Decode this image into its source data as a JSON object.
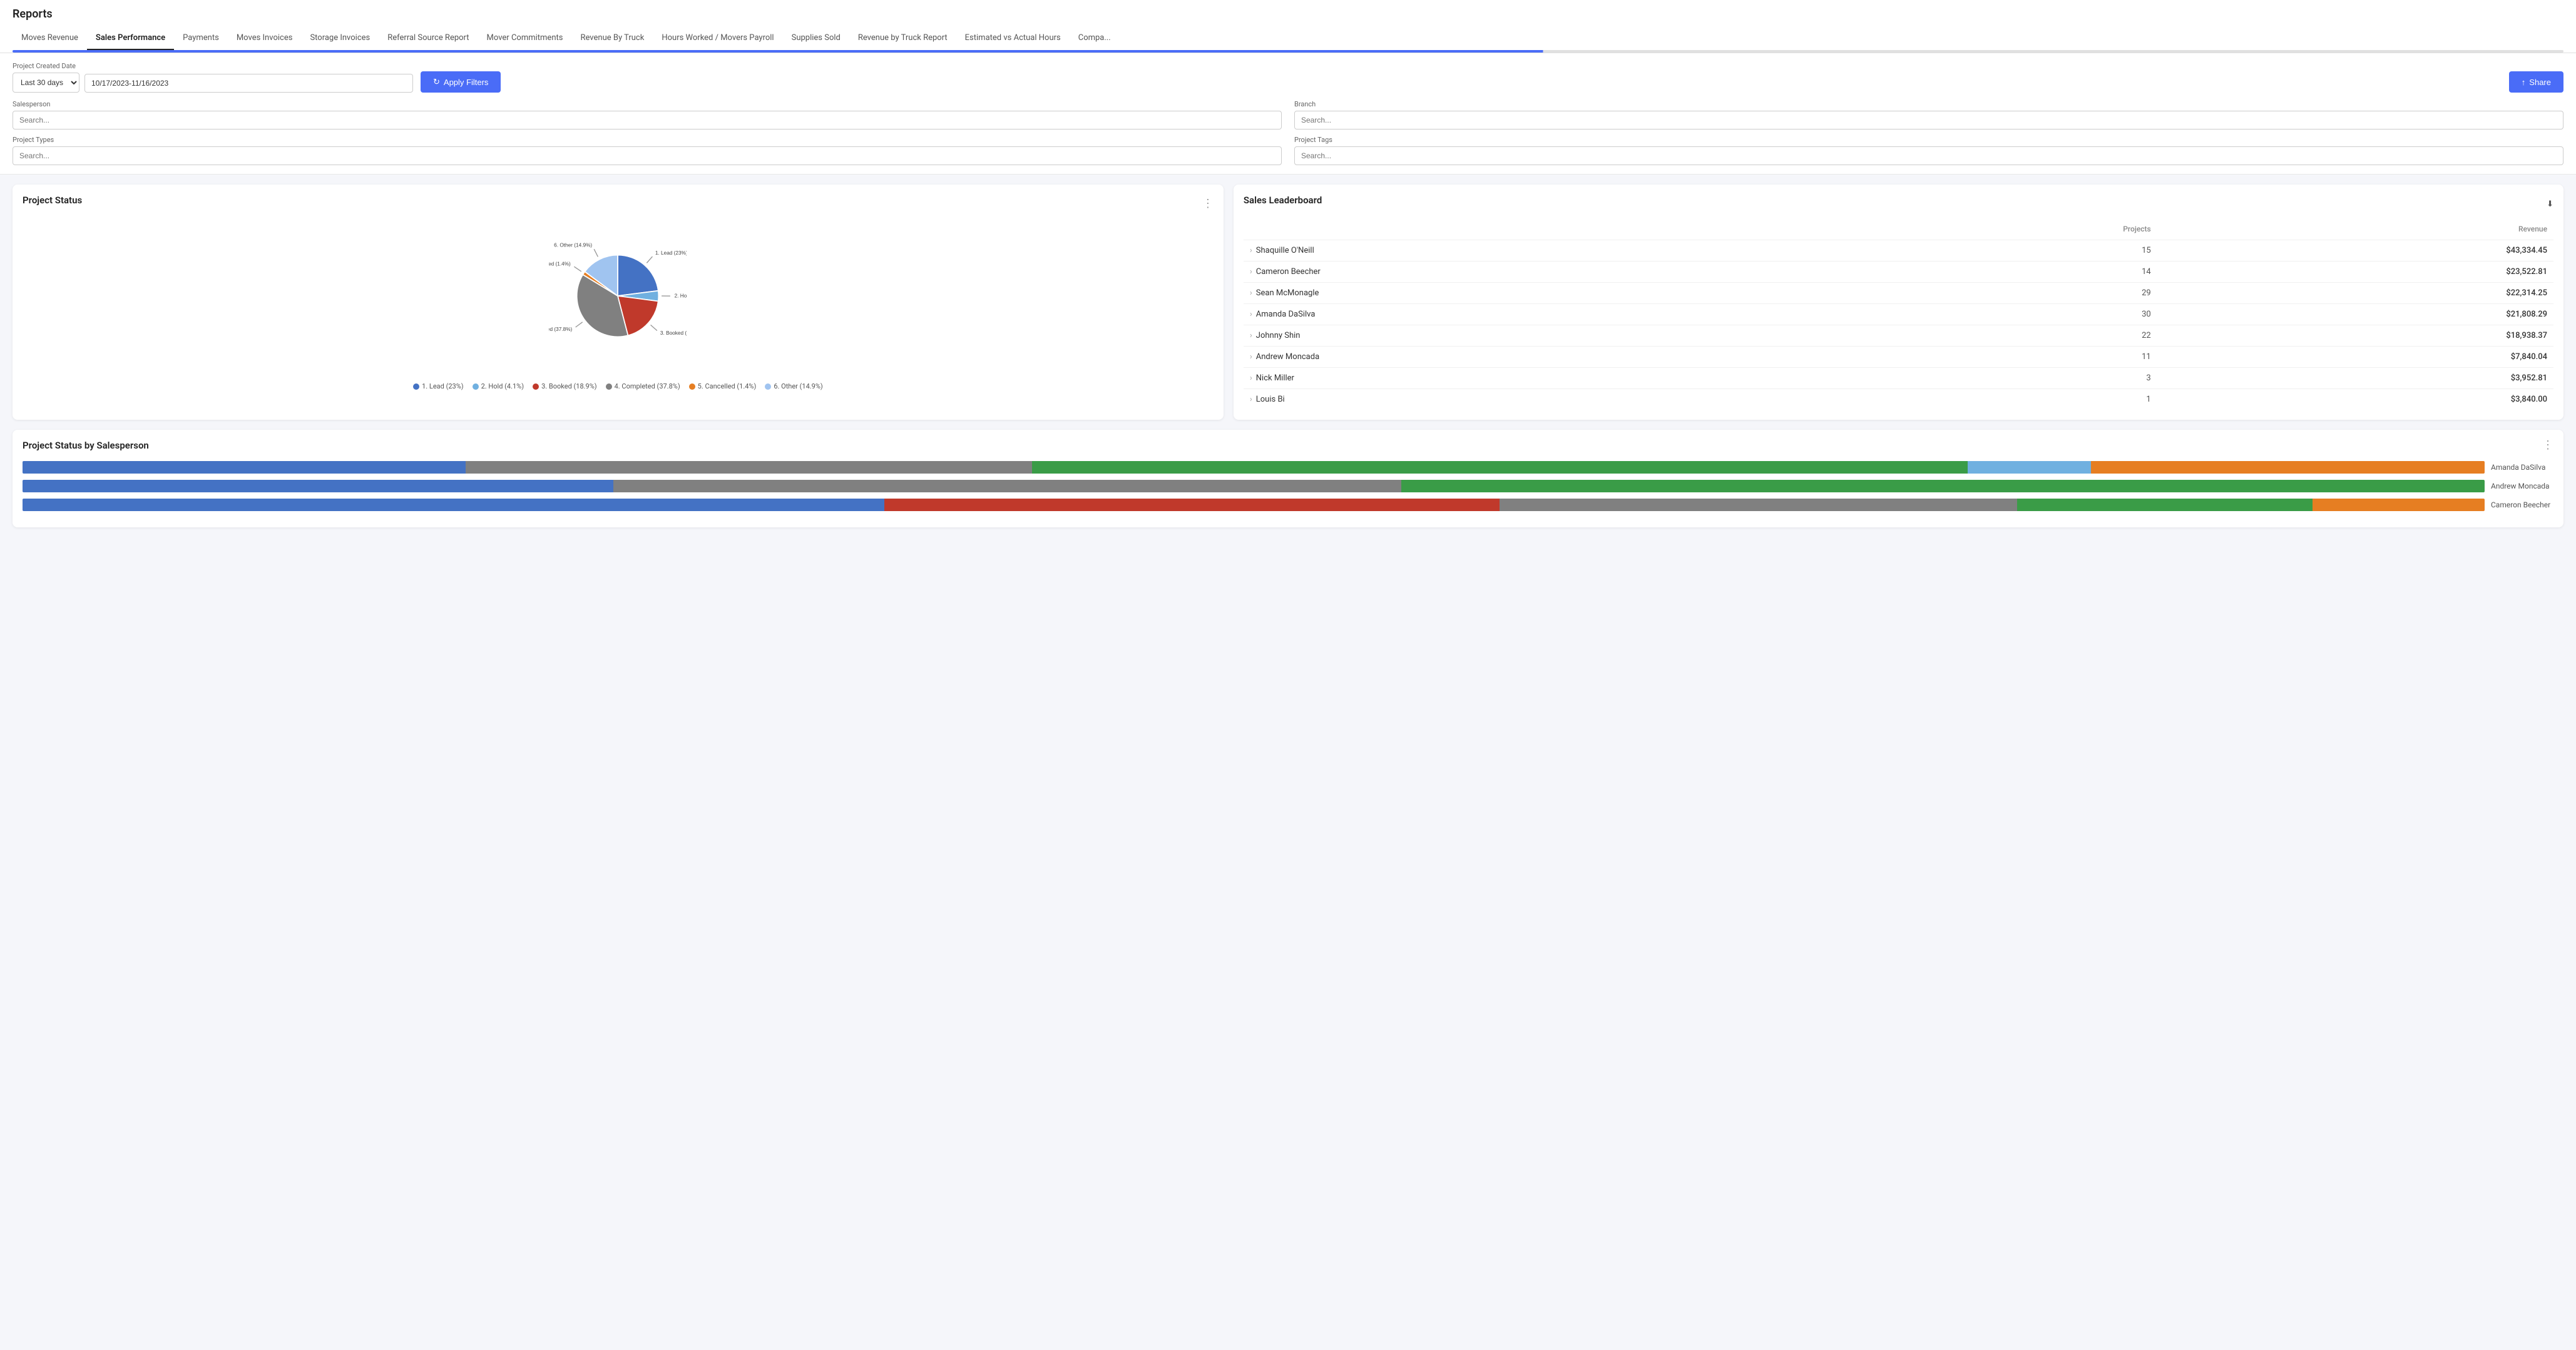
{
  "page": {
    "title": "Reports"
  },
  "tabs": {
    "items": [
      {
        "label": "Moves Revenue",
        "active": false
      },
      {
        "label": "Sales Performance",
        "active": true
      },
      {
        "label": "Payments",
        "active": false
      },
      {
        "label": "Moves Invoices",
        "active": false
      },
      {
        "label": "Storage Invoices",
        "active": false
      },
      {
        "label": "Referral Source Report",
        "active": false
      },
      {
        "label": "Mover Commitments",
        "active": false
      },
      {
        "label": "Revenue By Truck",
        "active": false
      },
      {
        "label": "Hours Worked / Movers Payroll",
        "active": false
      },
      {
        "label": "Supplies Sold",
        "active": false
      },
      {
        "label": "Revenue by Truck Report",
        "active": false
      },
      {
        "label": "Estimated vs Actual Hours",
        "active": false
      },
      {
        "label": "Compa...",
        "active": false
      }
    ]
  },
  "filters": {
    "date_label": "Project Created Date",
    "date_range_option": "Last 30 days",
    "date_range_value": "10/17/2023-11/16/2023",
    "apply_label": "Apply Filters",
    "share_label": "Share",
    "salesperson_label": "Salesperson",
    "salesperson_placeholder": "Search...",
    "branch_label": "Branch",
    "branch_placeholder": "Search...",
    "project_types_label": "Project Types",
    "project_types_placeholder": "Search...",
    "project_tags_label": "Project Tags",
    "project_tags_placeholder": "Search..."
  },
  "project_status": {
    "title": "Project Status",
    "segments": [
      {
        "label": "1. Lead",
        "pct": 23.0,
        "color": "#4472c4"
      },
      {
        "label": "2. Hold",
        "pct": 4.1,
        "color": "#70b0e0"
      },
      {
        "label": "3. Booked",
        "pct": 18.9,
        "color": "#c0392b"
      },
      {
        "label": "4. Completed",
        "pct": 37.8,
        "color": "#808080"
      },
      {
        "label": "5. Cancelled",
        "pct": 1.4,
        "color": "#e67e22"
      },
      {
        "label": "6. Other",
        "pct": 14.9,
        "color": "#a0c4f0"
      }
    ]
  },
  "leaderboard": {
    "title": "Sales Leaderboard",
    "col_projects": "Projects",
    "col_revenue": "Revenue",
    "rows": [
      {
        "name": "Shaquille O'Neill",
        "projects": 15,
        "revenue": "$43,334.45"
      },
      {
        "name": "Cameron Beecher",
        "projects": 14,
        "revenue": "$23,522.81"
      },
      {
        "name": "Sean McMonagle",
        "projects": 29,
        "revenue": "$22,314.25"
      },
      {
        "name": "Amanda DaSilva",
        "projects": 30,
        "revenue": "$21,808.29"
      },
      {
        "name": "Johnny Shin",
        "projects": 22,
        "revenue": "$18,938.37"
      },
      {
        "name": "Andrew Moncada",
        "projects": 11,
        "revenue": "$7,840.04"
      },
      {
        "name": "Nick Miller",
        "projects": 3,
        "revenue": "$3,952.81"
      },
      {
        "name": "Louis Bi",
        "projects": 1,
        "revenue": "$3,840.00"
      }
    ]
  },
  "salesperson_status": {
    "title": "Project Status by Salesperson",
    "rows": [
      {
        "name": "Amanda DaSilva",
        "segments": [
          {
            "color": "#4472c4",
            "pct": 18
          },
          {
            "color": "#808080",
            "pct": 23
          },
          {
            "color": "#3a9c47",
            "pct": 38
          },
          {
            "color": "#70b0e0",
            "pct": 5
          },
          {
            "color": "#e67e22",
            "pct": 16
          }
        ]
      },
      {
        "name": "Andrew Moncada",
        "segments": [
          {
            "color": "#4472c4",
            "pct": 24
          },
          {
            "color": "#808080",
            "pct": 32
          },
          {
            "color": "#3a9c47",
            "pct": 44
          }
        ]
      },
      {
        "name": "Cameron Beecher",
        "segments": [
          {
            "color": "#4472c4",
            "pct": 35
          },
          {
            "color": "#c0392b",
            "pct": 25
          },
          {
            "color": "#808080",
            "pct": 21
          },
          {
            "color": "#3a9c47",
            "pct": 12
          },
          {
            "color": "#e67e22",
            "pct": 7
          }
        ]
      }
    ]
  }
}
